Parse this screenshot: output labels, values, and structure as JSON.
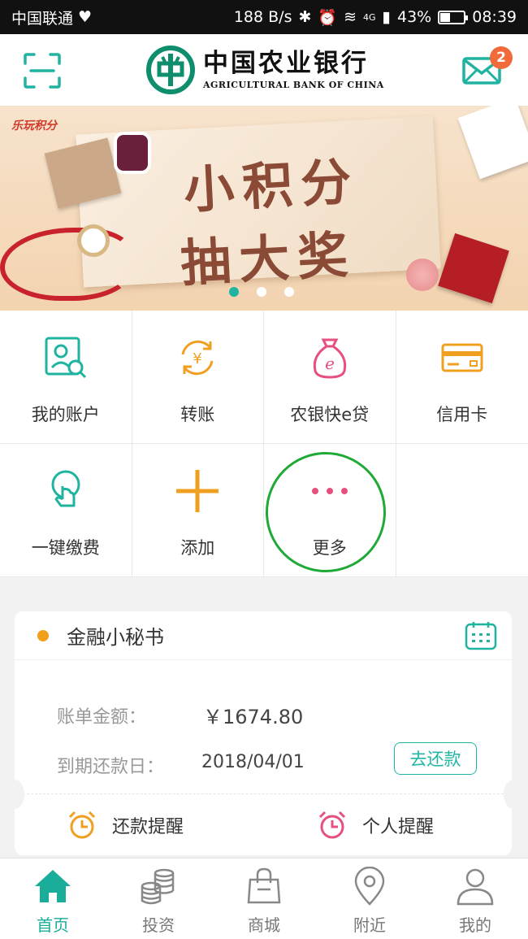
{
  "status_bar": {
    "carrier": "中国联通",
    "net_speed": "188 B/s",
    "signal_label": "4G",
    "battery": "43%",
    "battery_level": 0.43,
    "time": "08:39"
  },
  "header": {
    "bank_name_cn": "中国农业银行",
    "bank_name_en": "AGRICULTURAL BANK OF CHINA",
    "message_count": "2",
    "brand_color": "#1aae9a"
  },
  "banner": {
    "corner_logo": "乐玩积分",
    "line1": "小积分",
    "line2": "抽大奖",
    "active_dot_index": 0,
    "dot_count": 3
  },
  "quick_menu": {
    "items": [
      {
        "label": "我的账户",
        "icon": "account-icon"
      },
      {
        "label": "转账",
        "icon": "transfer-icon"
      },
      {
        "label": "农银快e贷",
        "icon": "loan-bag-icon"
      },
      {
        "label": "信用卡",
        "icon": "credit-card-icon"
      },
      {
        "label": "一键缴费",
        "icon": "tap-pay-icon"
      },
      {
        "label": "添加",
        "icon": "plus-icon"
      },
      {
        "label": "更多",
        "icon": "more-dots-icon"
      }
    ]
  },
  "finance": {
    "title": "金融小秘书",
    "bill_label": "账单金额：",
    "bill_amount": "￥1674.80",
    "due_label": "到期还款日：",
    "due_date": "2018/04/01",
    "repay_button": "去还款",
    "reminder_repay": "还款提醒",
    "reminder_personal": "个人提醒"
  },
  "bottom_nav": {
    "items": [
      {
        "label": "首页",
        "icon": "home-icon",
        "active": true
      },
      {
        "label": "投资",
        "icon": "coins-icon",
        "active": false
      },
      {
        "label": "商城",
        "icon": "shopping-bag-icon",
        "active": false
      },
      {
        "label": "附近",
        "icon": "location-pin-icon",
        "active": false
      },
      {
        "label": "我的",
        "icon": "user-icon",
        "active": false
      }
    ]
  }
}
